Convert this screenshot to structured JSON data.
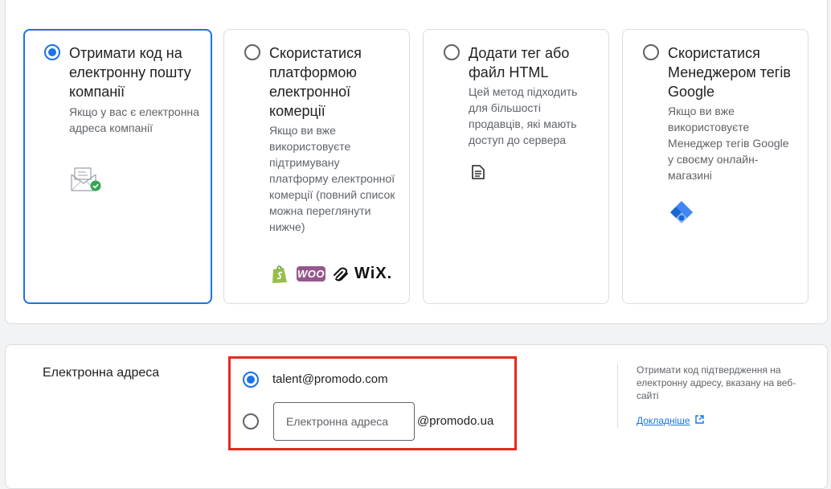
{
  "methods": [
    {
      "title": "Отримати код на електронну пошту компанії",
      "description": "Якщо у вас є електронна адреса компанії",
      "selected": true,
      "icon": "email-verified-icon"
    },
    {
      "title": "Скористатися платформою електронної комерції",
      "description": "Якщо ви вже використовуєте підтримувану платформу електронної комерції (повний список можна переглянути нижче)",
      "selected": false,
      "icon": "ecommerce-platform-icons",
      "platforms": {
        "shopify": "shopify-icon",
        "woo": "WOO",
        "squarespace": "squarespace-icon",
        "wix": "WiX."
      }
    },
    {
      "title": "Додати тег або файл HTML",
      "description": "Цей метод підходить для більшості продавців, які мають доступ до сервера",
      "selected": false,
      "icon": "file-icon"
    },
    {
      "title": "Скористатися Менеджером тегів Google",
      "description": "Якщо ви вже використовуєте Менеджер тегів Google у своєму онлайн-магазині",
      "selected": false,
      "icon": "tag-manager-icon"
    }
  ],
  "email_section": {
    "label": "Електронна адреса",
    "option_existing": "talent@promodo.com",
    "option_existing_selected": true,
    "input_placeholder": "Електронна адреса",
    "input_value": "",
    "domain_suffix": "@promodo.ua",
    "help_text": "Отримати код підтвердження на електронну адресу, вказану на веб-сайті",
    "help_link": "Докладніше",
    "accent": "#1a73e8",
    "highlight": "#e52a1f"
  }
}
